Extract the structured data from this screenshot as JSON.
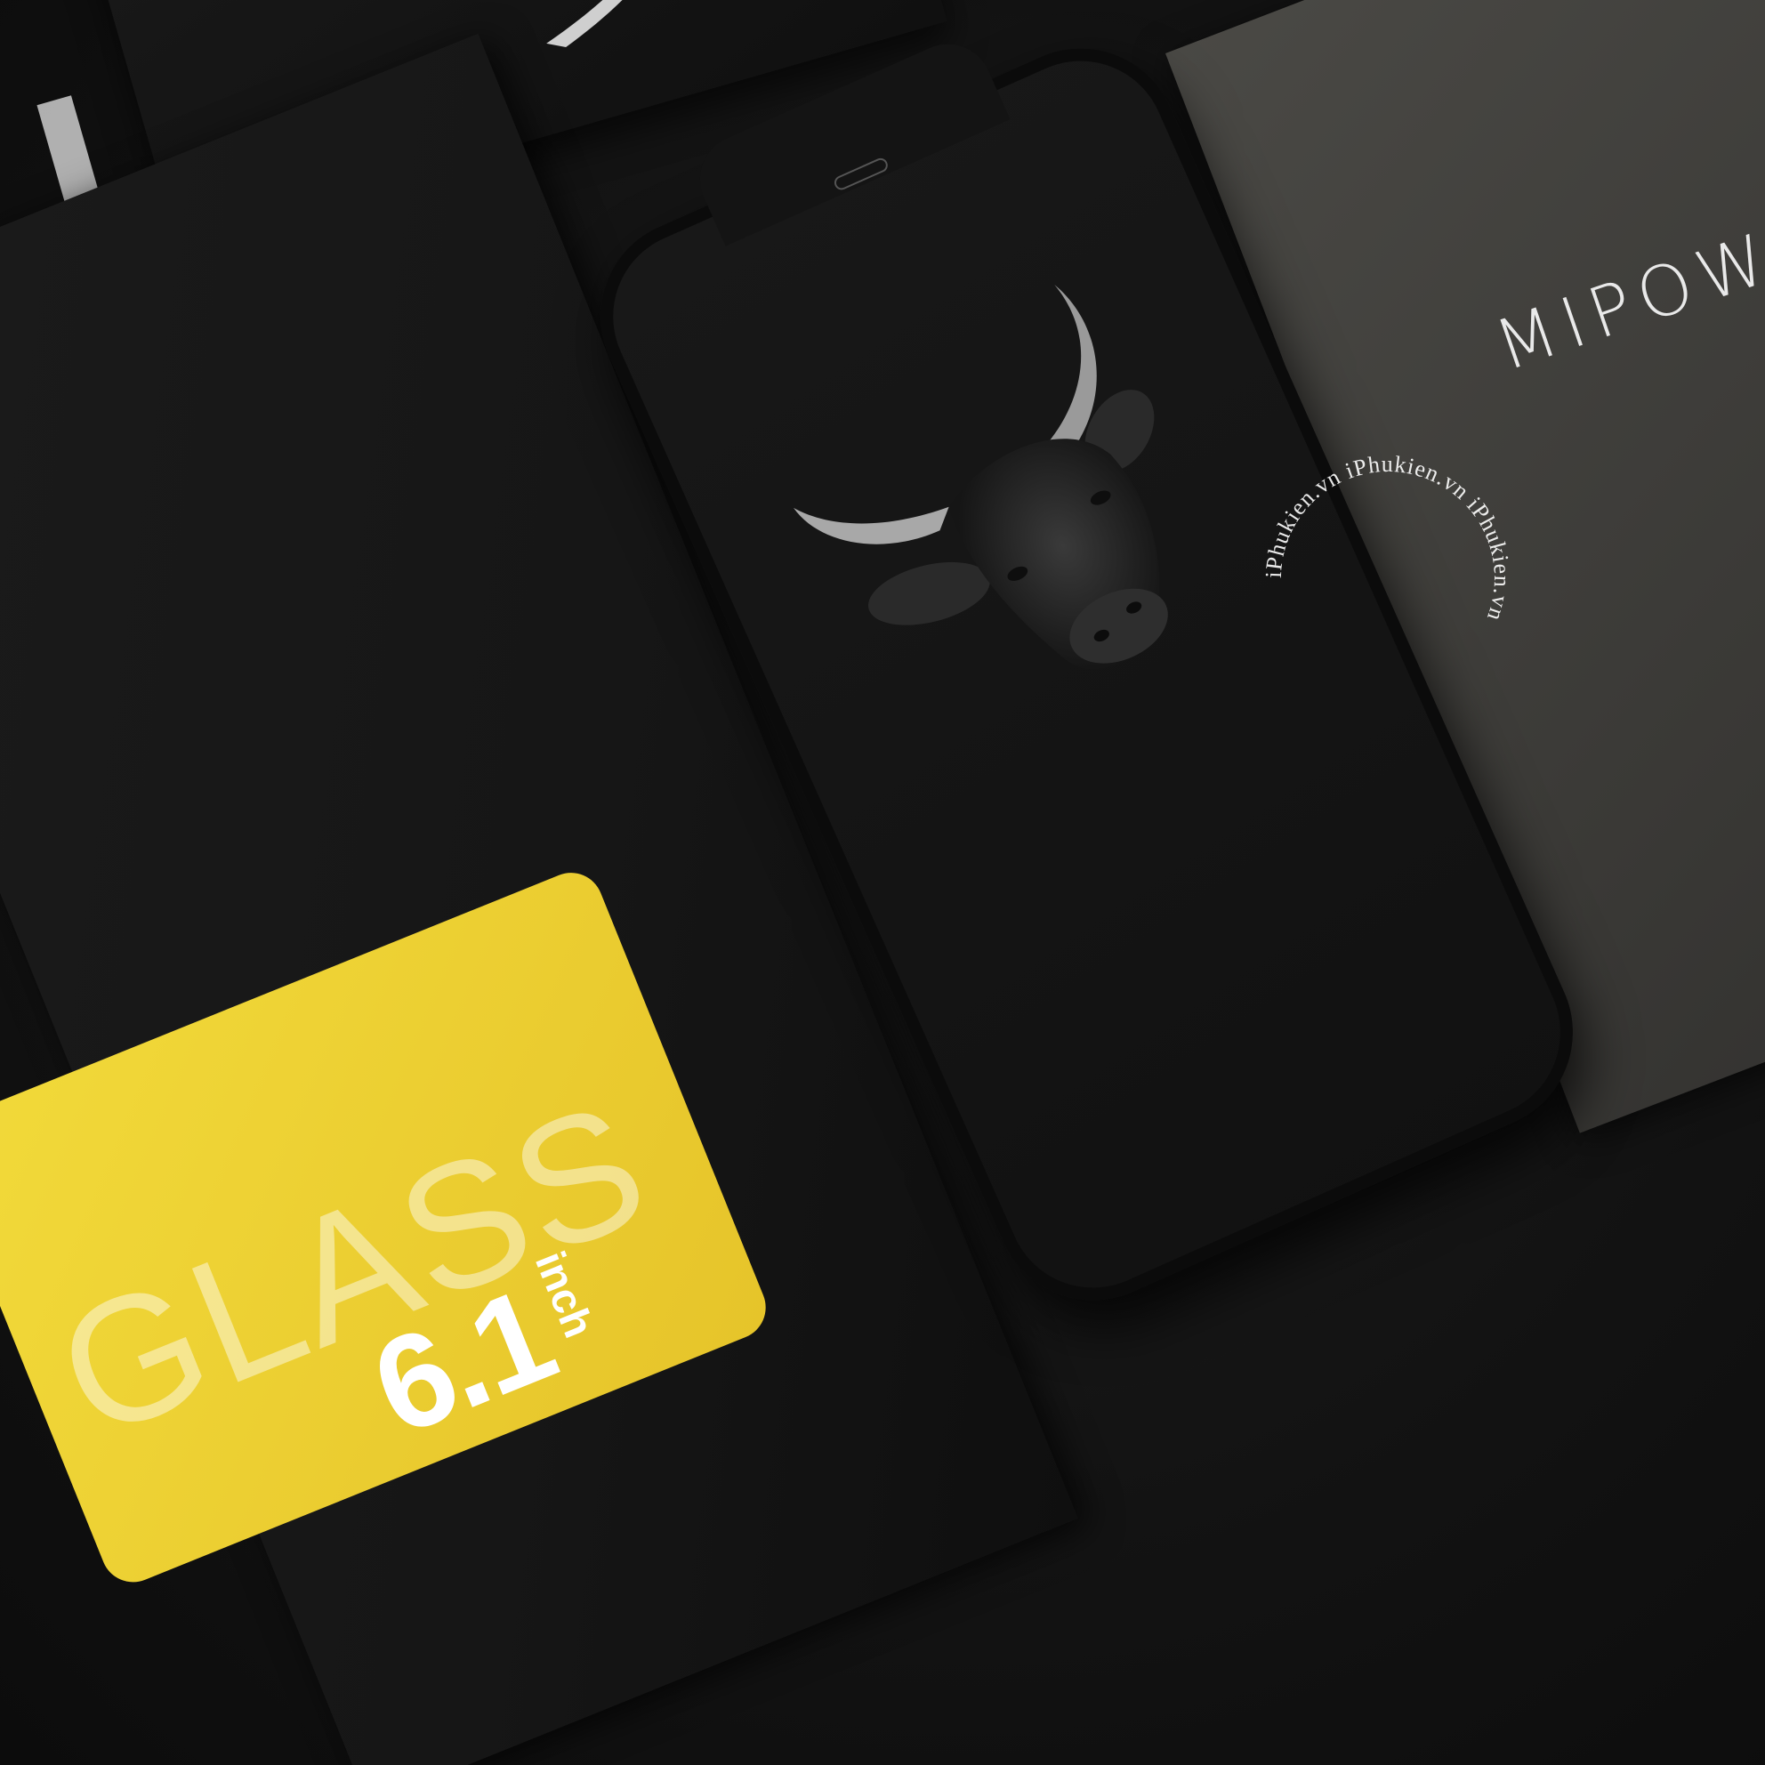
{
  "box_label": {
    "glass_word": "GLASS",
    "size_number": "6.1",
    "size_unit": "inch"
  },
  "sheet_brand": "MIPOW",
  "watermark_text": "iPhukien.vn  iPhukien.vn  iPhukien.vn",
  "colors": {
    "background": "#141414",
    "label_yellow": "#f2da3a",
    "sheet_gray": "#4a4945"
  }
}
